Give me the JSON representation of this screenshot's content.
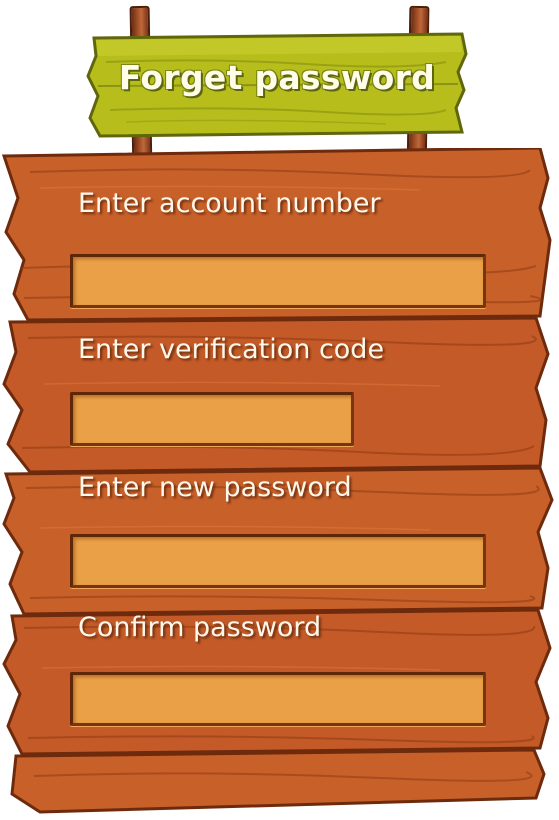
{
  "sign": {
    "title": "Forget password"
  },
  "form": {
    "fields": [
      {
        "label": "Enter account number",
        "value": "",
        "placeholder": ""
      },
      {
        "label": "Enter verification code",
        "value": "",
        "placeholder": ""
      },
      {
        "label": "Enter new password",
        "value": "",
        "placeholder": ""
      },
      {
        "label": "Confirm password",
        "value": "",
        "placeholder": ""
      }
    ]
  },
  "colors": {
    "sign_green": "#b5bc1a",
    "board_orange": "#c9622a",
    "input_fill": "#e9a046",
    "text_light": "#fff8ea"
  }
}
